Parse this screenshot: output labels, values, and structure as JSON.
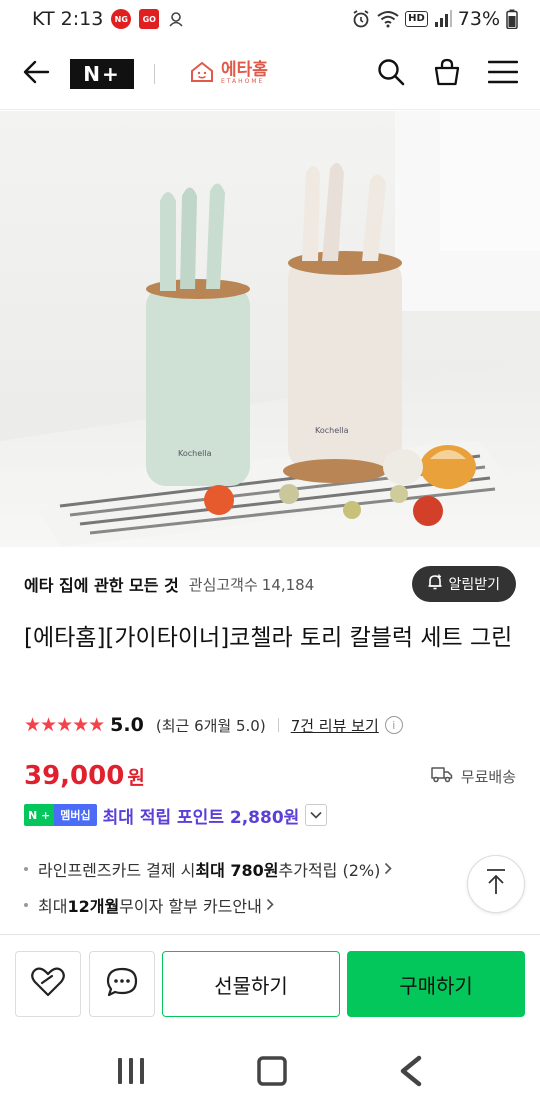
{
  "status_bar": {
    "carrier_time": "KT 2:13",
    "badge_ng": "NG",
    "badge_go": "GO",
    "hd": "HD",
    "battery": "73%"
  },
  "nav": {
    "npay_logo": "N+",
    "brand_name": "에타홈",
    "brand_sub": "ETAHOME"
  },
  "shop": {
    "name": "에타 집에 관한 모든 것",
    "interest_label": "관심고객수",
    "interest_count": "14,184",
    "alert_button": "알림받기"
  },
  "product": {
    "title": "[에타홈][가이타이너]코첼라 토리 칼블럭 세트 그린",
    "stars": "★★★★★",
    "rating": "5.0",
    "recent": "(최근 6개월 5.0)",
    "review_link": "7건 리뷰 보기",
    "price": "39,000",
    "currency": "원",
    "shipping": "무료배송"
  },
  "membership": {
    "badge_left": "N +",
    "badge_right": "멤버십",
    "text": "최대 적립 포인트 2,880원"
  },
  "benefits": [
    {
      "pre": "라인프렌즈카드 결제 시 ",
      "bold": "최대 780원",
      "post": " 추가적립 (2%)"
    },
    {
      "pre": "최대 ",
      "bold": "12개월",
      "post": " 무이자 할부 카드안내"
    }
  ],
  "actions": {
    "gift": "선물하기",
    "buy": "구매하기"
  },
  "colors": {
    "accent_green": "#03c75a",
    "price_red": "#e0202d",
    "member_purple": "#5b3fd6",
    "brand_coral": "#e05a4a"
  }
}
